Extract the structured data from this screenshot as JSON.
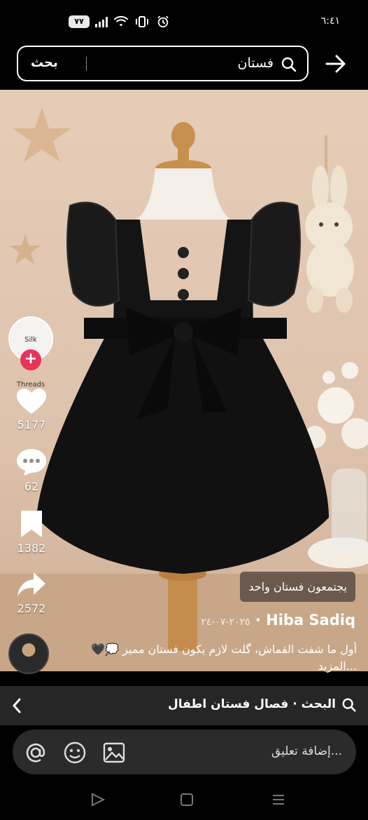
{
  "status": {
    "time": "٦:٤١",
    "battery": "٧٧"
  },
  "search": {
    "query": "فستان",
    "button_label": "بحث"
  },
  "post": {
    "brand_avatar_text": "Silk Threads",
    "likes": "5177",
    "comments": "62",
    "saves": "1382",
    "shares": "2572",
    "tag": "يجتمعون فستان واحد",
    "author": "Hiba Sadiq",
    "date": "٢٠٢٥-٠٧-٢٤",
    "caption": "أول ما شفت القماش، گلت لازم يكون فستان مميز 💭🖤",
    "caption_more": "...المزيد"
  },
  "related": {
    "label": "البحث · فصال فستان اطفال"
  },
  "comment_bar": {
    "placeholder": "إضافة تعليق..."
  },
  "icons": {
    "search": "search-icon",
    "back": "arrow-right-icon",
    "like": "heart-icon",
    "comment": "comment-bubble-icon",
    "save": "bookmark-icon",
    "share": "share-icon",
    "mention": "at-sign-icon",
    "emoji": "emoji-icon",
    "image": "image-icon"
  },
  "colors": {
    "accent_follow": "#e8335b",
    "background": "#000000",
    "related_bar": "#262626",
    "comment_input": "#2b2b2b"
  }
}
